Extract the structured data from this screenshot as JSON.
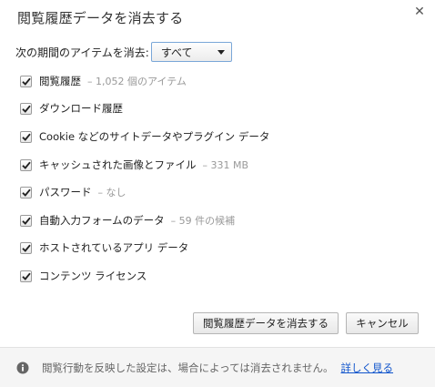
{
  "dialog": {
    "title": "閲覧履歴データを消去する",
    "close_icon": "close-icon"
  },
  "range": {
    "label": "次の期間のアイテムを消去:",
    "selected": "すべて"
  },
  "options": [
    {
      "label": "閲覧履歴",
      "detail": "– 1,052 個のアイテム",
      "checked": true
    },
    {
      "label": "ダウンロード履歴",
      "detail": "",
      "checked": true
    },
    {
      "label": "Cookie などのサイトデータやプラグイン データ",
      "detail": "",
      "checked": true
    },
    {
      "label": "キャッシュされた画像とファイル",
      "detail": "– 331 MB",
      "checked": true
    },
    {
      "label": "パスワード",
      "detail": "– なし",
      "checked": true
    },
    {
      "label": "自動入力フォームのデータ",
      "detail": "– 59 件の候補",
      "checked": true
    },
    {
      "label": "ホストされているアプリ データ",
      "detail": "",
      "checked": true
    },
    {
      "label": "コンテンツ ライセンス",
      "detail": "",
      "checked": true
    }
  ],
  "buttons": {
    "clear": "閲覧履歴データを消去する",
    "cancel": "キャンセル"
  },
  "footer": {
    "message": "閲覧行動を反映した設定は、場合によっては消去されません。",
    "link": "詳しく見る",
    "icon": "info-icon"
  },
  "colors": {
    "link": "#1155cc",
    "footer_bg": "#f5f5f5",
    "select_border": "#7aa7d8"
  }
}
